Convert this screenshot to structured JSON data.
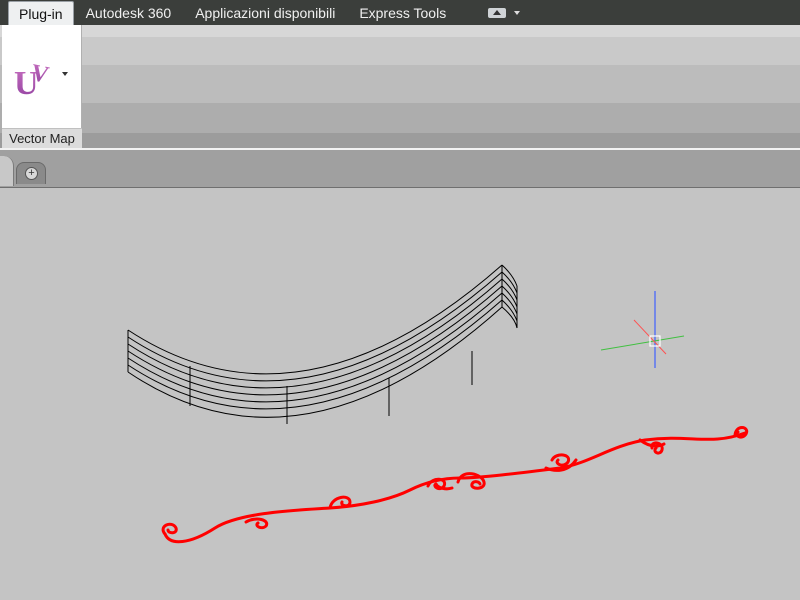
{
  "ribbon": {
    "tabs": [
      {
        "label": "Plug-in",
        "active": true
      },
      {
        "label": "Autodesk 360"
      },
      {
        "label": "Applicazioni disponibili"
      },
      {
        "label": "Express Tools"
      }
    ],
    "panel": {
      "title": "Vector Map",
      "tool_icon": "uv-map-icon"
    }
  },
  "doc_tabs": {
    "new_tab_icon": "add-tab-icon"
  },
  "colors": {
    "tabbar_bg": "#3b3e3b",
    "canvas_bg": "#c4c4c4",
    "ornament": "#ff0000",
    "wireframe": "#000000",
    "ucs_x": "#ff5050",
    "ucs_y": "#40c040",
    "ucs_z": "#4060ff"
  }
}
